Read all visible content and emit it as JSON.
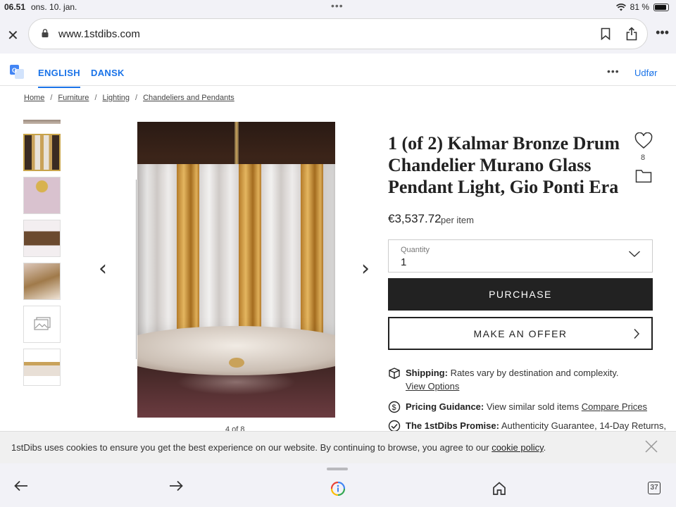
{
  "status_bar": {
    "time": "06.51",
    "date": "ons. 10. jan.",
    "battery": "81 %"
  },
  "browser": {
    "url": "www.1stdibs.com"
  },
  "translate_bar": {
    "lang_primary": "ENGLISH",
    "lang_secondary": "DANSK",
    "done_label": "Udfør"
  },
  "breadcrumb": [
    "Home",
    "Furniture",
    "Lighting",
    "Chandeliers and Pendants"
  ],
  "gallery": {
    "counter": "4 of 8",
    "thumb_count": 6
  },
  "product": {
    "title": "1 (of 2) Kalmar Bronze Drum Chandelier Murano Glass Pendant Light, Gio Ponti Era",
    "favorites": "8",
    "price": "€3,537.72",
    "price_unit": "per item",
    "quantity_label": "Quantity",
    "quantity_value": "1",
    "purchase_label": "PURCHASE",
    "offer_label": "MAKE AN OFFER"
  },
  "info": {
    "shipping_label": "Shipping:",
    "shipping_text": "Rates vary by destination and complexity.",
    "shipping_link": "View Options",
    "pricing_label": "Pricing Guidance:",
    "pricing_text": "View similar sold items",
    "pricing_link": "Compare Prices",
    "promise_label": "The 1stDibs Promise:",
    "promise_text": "Authenticity Guarantee, 14-Day Returns,"
  },
  "cookie": {
    "message": "1stDibs uses cookies to ensure you get the best experience on our website. By continuing to browse, you agree to our",
    "link": "cookie policy",
    "end": "."
  },
  "toolbar": {
    "tabs_count": "37"
  },
  "colors": {
    "link_blue": "#1a73e8",
    "button_dark": "#222222",
    "selected_thumb": "#c8a44a"
  }
}
